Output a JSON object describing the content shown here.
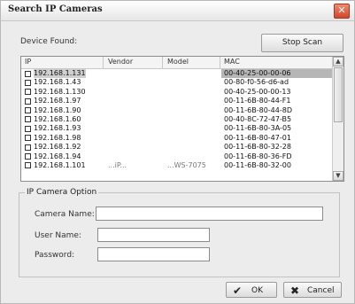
{
  "window": {
    "title": "Search IP Cameras",
    "close_glyph": "✕"
  },
  "device_found_label": "Device Found:",
  "stop_scan_label": "Stop Scan",
  "table": {
    "headers": [
      "IP",
      "Vendor",
      "Model",
      "MAC"
    ],
    "rows": [
      {
        "ip": "192.168.1.131",
        "mac": "00-40-25-00-00-06"
      },
      {
        "ip": "192.168.1.43",
        "mac": "00-80-f0-56-d6-ad"
      },
      {
        "ip": "192.168.1.130",
        "mac": "00-40-25-00-00-13"
      },
      {
        "ip": "192.168.1.97",
        "mac": "00-11-6B-80-44-F1"
      },
      {
        "ip": "192.168.1.90",
        "mac": "00-11-6B-80-44-8D"
      },
      {
        "ip": "192.168.1.60",
        "mac": "00-40-8C-72-47-B5"
      },
      {
        "ip": "192.168.1.93",
        "mac": "00-11-6B-80-3A-05"
      },
      {
        "ip": "192.168.1.98",
        "mac": "00-11-6B-80-47-01"
      },
      {
        "ip": "192.168.1.92",
        "mac": "00-11-6B-80-32-28"
      },
      {
        "ip": "192.168.1.94",
        "mac": "00-11-6B-80-36-FD"
      }
    ],
    "partial_row": {
      "ip": "192.168.1.101",
      "vendor": "...iP...",
      "model": "...WS-7075",
      "mac": "00-11-6B-80-32-00"
    },
    "scroll_up_glyph": "▲",
    "scroll_down_glyph": "▼"
  },
  "option_group_title": "IP Camera Option",
  "fields": {
    "camera_name_label": "Camera Name:",
    "user_name_label": "User Name:",
    "password_label": "Password:",
    "camera_name_value": "",
    "user_name_value": "",
    "password_value": ""
  },
  "buttons": {
    "ok_label": "OK",
    "ok_icon": "✔",
    "cancel_label": "Cancel",
    "cancel_icon": "✖"
  },
  "icons": {
    "close": "close-icon",
    "ok": "check-icon",
    "cancel": "x-icon"
  },
  "colors": {
    "window_bg": "#ececec",
    "selected_row": "#b6b6b6",
    "close_btn": "#d0472a"
  }
}
